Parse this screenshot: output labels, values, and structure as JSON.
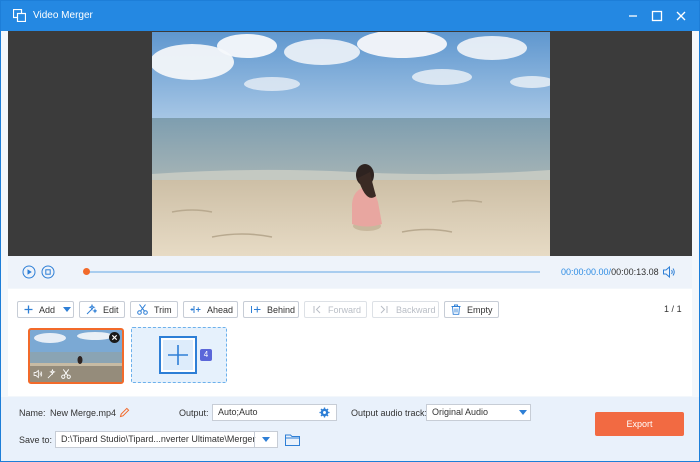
{
  "window": {
    "title": "Video Merger"
  },
  "player": {
    "current_time": "00:00:00.00",
    "separator": "/",
    "duration": "00:00:13.08",
    "progress": 0
  },
  "toolbar": {
    "add_label": "Add",
    "edit_label": "Edit",
    "trim_label": "Trim",
    "ahead_label": "Ahead",
    "behind_label": "Behind",
    "forward_label": "Forward",
    "backward_label": "Backward",
    "empty_label": "Empty",
    "page_current": "1",
    "page_sep": "/",
    "page_total": "1"
  },
  "clips": {
    "add_slot_badge": "4"
  },
  "bottom": {
    "name_label": "Name:",
    "name_value": "New Merge.mp4",
    "output_label": "Output:",
    "output_value": "Auto;Auto",
    "audio_track_label": "Output audio track:",
    "audio_track_value": "Original Audio",
    "save_to_label": "Save to:",
    "save_to_value": "D:\\Tipard Studio\\Tipard...nverter Ultimate\\Merger",
    "export_label": "Export"
  },
  "colors": {
    "titlebar": "#2488e2",
    "accent": "#2d8ce4",
    "export": "#f26a42",
    "selected_clip_border": "#f26a2a"
  },
  "icons": [
    "app-icon",
    "minimize-icon",
    "maximize-icon",
    "close-icon",
    "play-icon",
    "stop-icon",
    "volume-icon",
    "plus-icon",
    "magic-wand-icon",
    "scissors-icon",
    "gear-icon",
    "pencil-icon",
    "folder-icon"
  ]
}
